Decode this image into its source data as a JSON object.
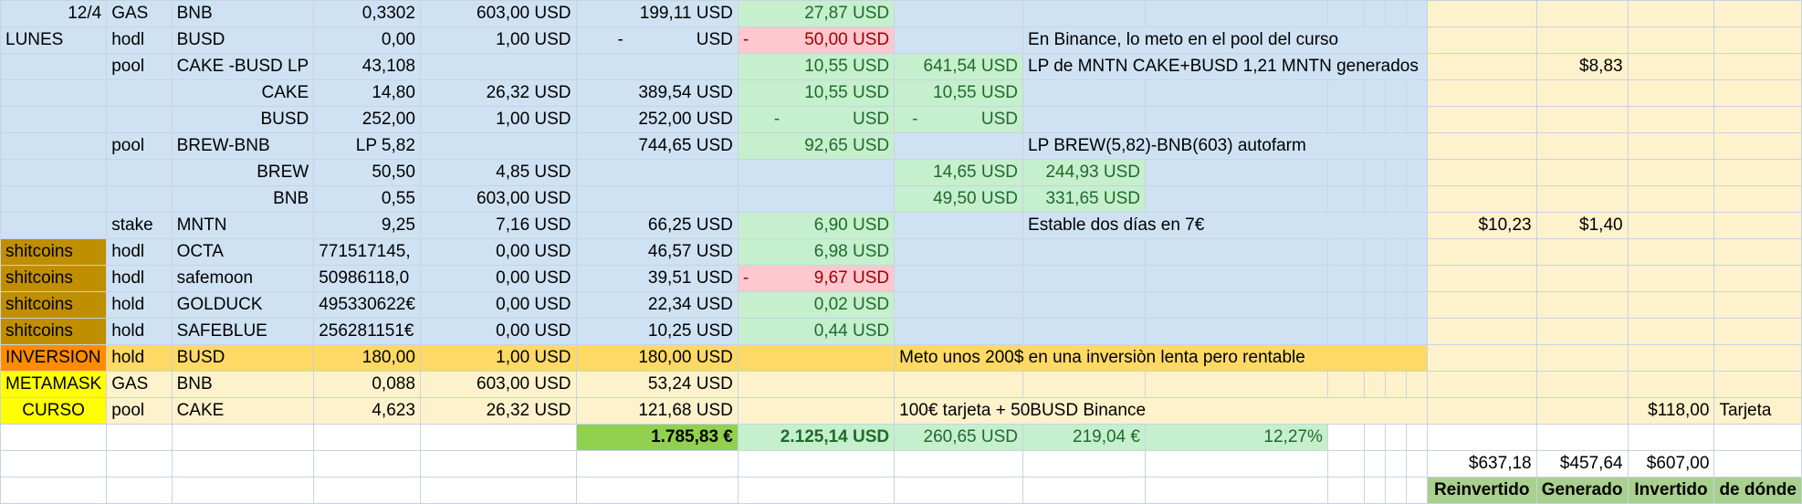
{
  "rows": [
    {
      "a": "12/4",
      "b": "GAS",
      "c": "BNB",
      "d": "0,3302",
      "e": "603,00 USD",
      "f": "199,11 USD",
      "g": "27,87 USD",
      "h": "",
      "i": "",
      "n": "",
      "o": "",
      "p": "",
      "q": ""
    },
    {
      "a": "LUNES",
      "b": "hodl",
      "c": "BUSD",
      "d": "0,00",
      "e": "1,00 USD",
      "f_left": "-",
      "f_right": "USD",
      "g_left": "-",
      "g_right": "50,00 USD",
      "h": "",
      "i": "En Binance, lo meto en el pool del curso",
      "n": "",
      "o": "",
      "p": "",
      "q": ""
    },
    {
      "a": "",
      "b": "pool",
      "c": "CAKE -BUSD LP",
      "d": "43,108",
      "e": "",
      "f": "",
      "g": "10,55 USD",
      "h": "641,54 USD",
      "i": "LP de MNTN CAKE+BUSD 1,21 MNTN generados",
      "n": "",
      "o": "$8,83",
      "p": "",
      "q": ""
    },
    {
      "a": "",
      "b": "",
      "c": "CAKE",
      "d": "14,80",
      "e": "26,32 USD",
      "f": "389,54 USD",
      "g": "10,55 USD",
      "h": "10,55 USD",
      "i": "",
      "n": "",
      "o": "",
      "p": "",
      "q": ""
    },
    {
      "a": "",
      "b": "",
      "c": "BUSD",
      "d": "252,00",
      "e": "1,00 USD",
      "f": "252,00 USD",
      "g_left": "-",
      "g_right": "USD",
      "h_left": "-",
      "h_right": "USD",
      "i": "",
      "n": "",
      "o": "",
      "p": "",
      "q": ""
    },
    {
      "a": "",
      "b": "pool",
      "c": "BREW-BNB",
      "d": "LP 5,82",
      "e": "",
      "f": "744,65 USD",
      "g": "92,65 USD",
      "h": "",
      "i": "LP BREW(5,82)-BNB(603) autofarm",
      "n": "",
      "o": "",
      "p": "",
      "q": ""
    },
    {
      "a": "",
      "b": "",
      "c": "BREW",
      "d": "50,50",
      "e": "4,85 USD",
      "f": "",
      "g": "",
      "h": "14,65 USD",
      "i": "244,93 USD",
      "n": "",
      "o": "",
      "p": "",
      "q": ""
    },
    {
      "a": "",
      "b": "",
      "c": "BNB",
      "d": "0,55",
      "e": "603,00 USD",
      "f": "",
      "g": "",
      "h": "49,50 USD",
      "i": "331,65 USD",
      "n": "",
      "o": "",
      "p": "",
      "q": ""
    },
    {
      "a": "",
      "b": "stake",
      "c": "MNTN",
      "d": "9,25",
      "e": "7,16 USD",
      "f": "66,25 USD",
      "g": "6,90 USD",
      "h": "",
      "i": "Estable dos días en 7€",
      "n": "$10,23",
      "o": "$1,40",
      "p": "",
      "q": ""
    },
    {
      "a": "shitcoins",
      "b": "hodl",
      "c": "OCTA",
      "d": "771517145,",
      "e": "0,00 USD",
      "f": "46,57 USD",
      "g": "6,98 USD",
      "h": "",
      "i": "",
      "n": "",
      "o": "",
      "p": "",
      "q": ""
    },
    {
      "a": "shitcoins",
      "b": "hodl",
      "c": "safemoon",
      "d": "50986118,0",
      "e": "0,00 USD",
      "f": "39,51 USD",
      "g_left": "-",
      "g_right": "9,67 USD",
      "h": "",
      "i": "",
      "n": "",
      "o": "",
      "p": "",
      "q": ""
    },
    {
      "a": "shitcoins",
      "b": "hold",
      "c": "GOLDUCK",
      "d": "495330622€",
      "e": "0,00 USD",
      "f": "22,34 USD",
      "g": "0,02 USD",
      "h": "",
      "i": "",
      "n": "",
      "o": "",
      "p": "",
      "q": ""
    },
    {
      "a": "shitcoins",
      "b": "hold",
      "c": "SAFEBLUE",
      "d": "256281151€",
      "e": "0,00 USD",
      "f": "10,25 USD",
      "g": "0,44 USD",
      "h": "",
      "i": "",
      "n": "",
      "o": "",
      "p": "",
      "q": ""
    },
    {
      "a": "INVERSION",
      "b": "hold",
      "c": "BUSD",
      "d": "180,00",
      "e": "1,00 USD",
      "f": "180,00 USD",
      "g": "",
      "h": "Meto unos 200$ en una inversiòn lenta pero rentable",
      "n": "",
      "o": "",
      "p": "",
      "q": ""
    },
    {
      "a": "METAMASK",
      "b": "GAS",
      "c": "BNB",
      "d": "0,088",
      "e": "603,00 USD",
      "f": "53,24 USD",
      "g": "",
      "h": "",
      "n": "",
      "o": "",
      "p": "",
      "q": ""
    },
    {
      "a": "CURSO",
      "b": "pool",
      "c": "CAKE",
      "d": "4,623",
      "e": "26,32 USD",
      "f": "121,68 USD",
      "g": "",
      "h": "100€ tarjeta + 50BUSD Binance",
      "n": "",
      "o": "",
      "p": "$118,00",
      "q": "Tarjeta"
    },
    {
      "f": "1.785,83 €",
      "g": "2.125,14 USD",
      "h": "260,65 USD",
      "i": "219,04 €",
      "j": "12,27%"
    },
    {
      "n": "$637,18",
      "o": "$457,64",
      "p": "$607,00"
    },
    {
      "n": "Reinvertido",
      "o": "Generado",
      "p": "Invertido",
      "q": "de dónde"
    }
  ],
  "colors": {
    "blue_fill": "#cfe2f3",
    "light_yellow_fill": "#fef2cc",
    "yellow_fill": "#ffd966",
    "green_fill": "#c6efce",
    "red_fill": "#ffc7ce",
    "olive_fill": "#bf8f00",
    "orange_fill": "#ff8c00",
    "bright_yellow_fill": "#ffff00",
    "total_green": "#92d050",
    "header_green": "#a9d08e"
  }
}
